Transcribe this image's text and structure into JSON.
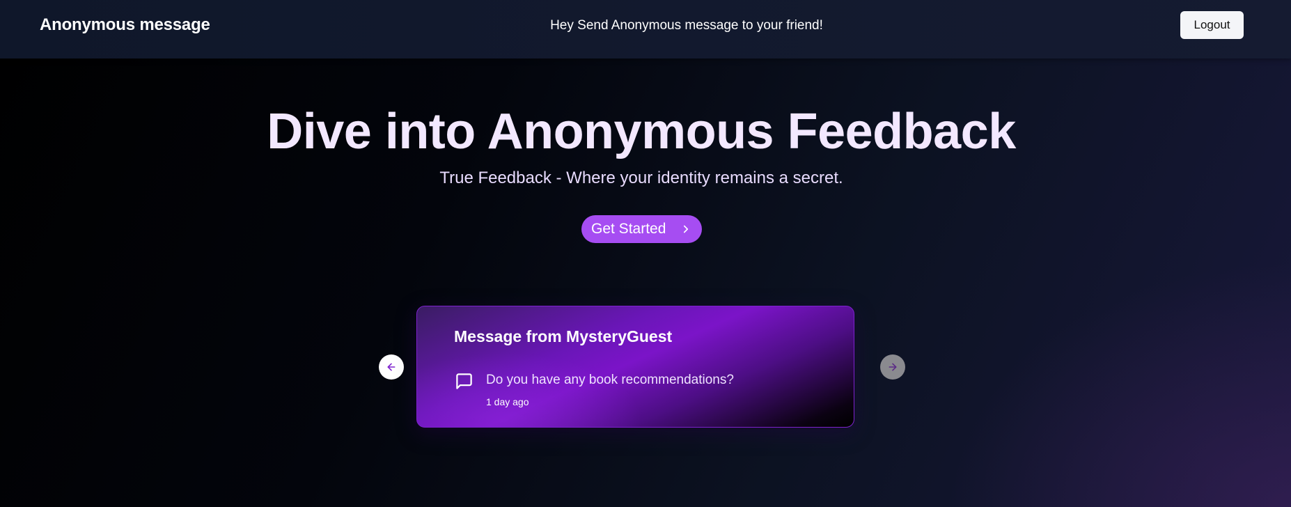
{
  "navbar": {
    "brand": "Anonymous message",
    "tagline": "Hey Send Anonymous message to your friend!",
    "logout_label": "Logout"
  },
  "hero": {
    "title": "Dive into Anonymous Feedback",
    "subtitle": "True Feedback - Where your identity remains a secret.",
    "cta_label": "Get Started",
    "cta_icon": "chevron-right-icon"
  },
  "carousel": {
    "prev_icon": "arrow-left-icon",
    "next_icon": "arrow-right-icon",
    "card": {
      "title": "Message from MysteryGuest",
      "icon": "message-square-icon",
      "content": "Do you have any book recommendations?",
      "time": "1 day ago"
    }
  },
  "colors": {
    "accent": "#a64df2",
    "card_purple": "#7e22ce",
    "navbar": "#0f172a",
    "heading": "#f3e8ff"
  }
}
